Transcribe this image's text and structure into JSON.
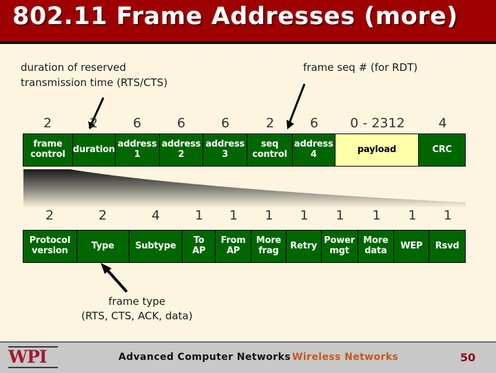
{
  "slide": {
    "title": "802.11 Frame Addresses (more)",
    "colors": {
      "title_bar": "#9e0000",
      "background": "#fdf5e0",
      "field_green": "#006600",
      "payload_yellow": "#ffffaa",
      "footer_gray": "#c8c8c8",
      "wpi_red": "#9e1b32",
      "topic_orange": "#c05a1c"
    }
  },
  "annotations": {
    "duration_note": "duration of reserved\ntransmission time (RTS/CTS)",
    "seq_note": "frame seq # (for RDT)",
    "type_note": "frame type\n(RTS, CTS, ACK, data)"
  },
  "frame_row": {
    "sizes": [
      "2",
      "2",
      "6",
      "6",
      "6",
      "2",
      "6",
      "0 - 2312",
      "4"
    ],
    "fields": [
      {
        "label": "frame\ncontrol",
        "kind": "header"
      },
      {
        "label": "duration",
        "kind": "header"
      },
      {
        "label": "address\n1",
        "kind": "header"
      },
      {
        "label": "address\n2",
        "kind": "header"
      },
      {
        "label": "address\n3",
        "kind": "header"
      },
      {
        "label": "seq\ncontrol",
        "kind": "header"
      },
      {
        "label": "address\n4",
        "kind": "header"
      },
      {
        "label": "payload",
        "kind": "payload"
      },
      {
        "label": "CRC",
        "kind": "header"
      }
    ]
  },
  "frame_control_row": {
    "sizes": [
      "2",
      "2",
      "4",
      "1",
      "1",
      "1",
      "1",
      "1",
      "1",
      "1",
      "1"
    ],
    "fields": [
      {
        "label": "Protocol\nversion"
      },
      {
        "label": "Type"
      },
      {
        "label": "Subtype"
      },
      {
        "label": "To\nAP"
      },
      {
        "label": "From\nAP"
      },
      {
        "label": "More\nfrag"
      },
      {
        "label": "Retry"
      },
      {
        "label": "Power\nmgt"
      },
      {
        "label": "More\ndata"
      },
      {
        "label": "WEP"
      },
      {
        "label": "Rsvd"
      }
    ]
  },
  "footer": {
    "logo_text": "WPI",
    "course": "Advanced Computer Networks",
    "topic": "Wireless Networks",
    "page_number": "50"
  }
}
